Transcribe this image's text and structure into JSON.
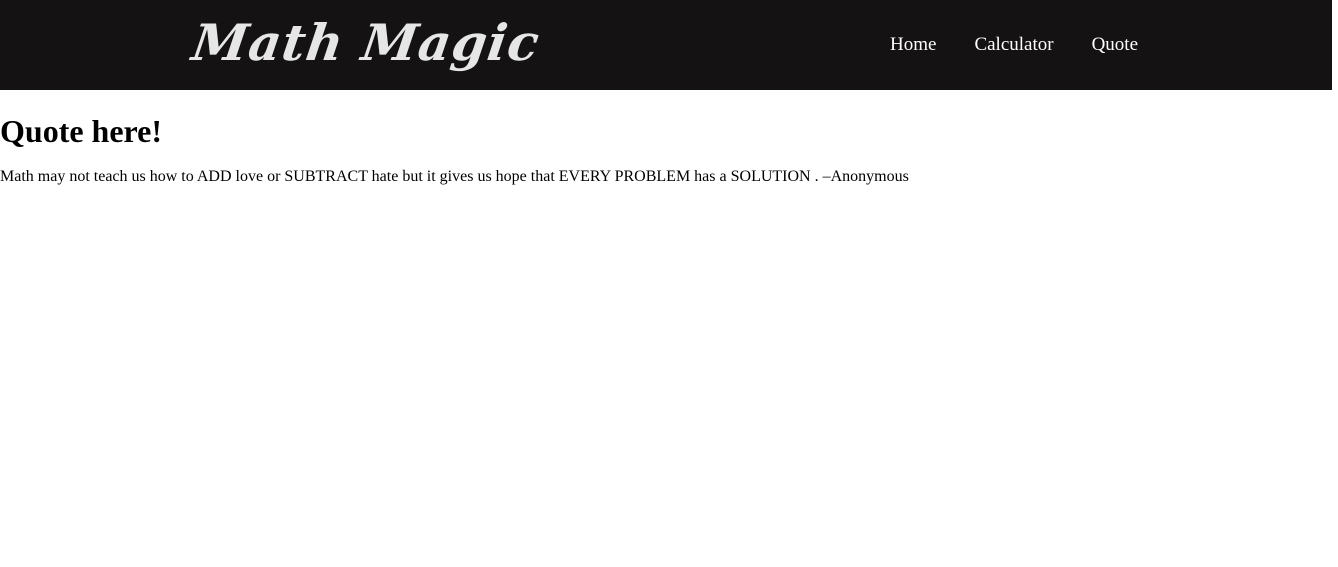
{
  "header": {
    "logo_text": "Math Magic",
    "nav": [
      {
        "label": "Home"
      },
      {
        "label": "Calculator"
      },
      {
        "label": "Quote"
      }
    ]
  },
  "main": {
    "title": "Quote here!",
    "quote": "Math may not teach us how to ADD love or SUBTRACT hate but it gives us hope that EVERY PROBLEM has a SOLUTION . –Anonymous"
  },
  "colors": {
    "header_background": "#141213",
    "logo_color": "#e6e6e6",
    "nav_text": "#ffffff",
    "body_text": "#000000"
  }
}
